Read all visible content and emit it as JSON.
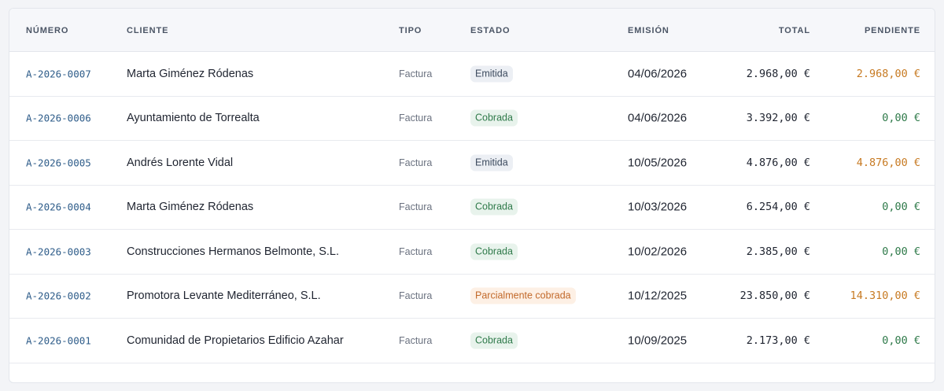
{
  "table": {
    "headers": {
      "numero": "NÚMERO",
      "cliente": "CLIENTE",
      "tipo": "TIPO",
      "estado": "ESTADO",
      "emision": "EMISIÓN",
      "total": "TOTAL",
      "pendiente": "PENDIENTE"
    },
    "rows": [
      {
        "numero": "A-2026-0007",
        "cliente": "Marta Giménez Ródenas",
        "tipo": "Factura",
        "estado": "Emitida",
        "emision": "04/06/2026",
        "total": "2.968,00 €",
        "pendiente": "2.968,00 €"
      },
      {
        "numero": "A-2026-0006",
        "cliente": "Ayuntamiento de Torrealta",
        "tipo": "Factura",
        "estado": "Cobrada",
        "emision": "04/06/2026",
        "total": "3.392,00 €",
        "pendiente": "0,00 €"
      },
      {
        "numero": "A-2026-0005",
        "cliente": "Andrés Lorente Vidal",
        "tipo": "Factura",
        "estado": "Emitida",
        "emision": "10/05/2026",
        "total": "4.876,00 €",
        "pendiente": "4.876,00 €"
      },
      {
        "numero": "A-2026-0004",
        "cliente": "Marta Giménez Ródenas",
        "tipo": "Factura",
        "estado": "Cobrada",
        "emision": "10/03/2026",
        "total": "6.254,00 €",
        "pendiente": "0,00 €"
      },
      {
        "numero": "A-2026-0003",
        "cliente": "Construcciones Hermanos Belmonte, S.L.",
        "tipo": "Factura",
        "estado": "Cobrada",
        "emision": "10/02/2026",
        "total": "2.385,00 €",
        "pendiente": "0,00 €"
      },
      {
        "numero": "A-2026-0002",
        "cliente": "Promotora Levante Mediterráneo, S.L.",
        "tipo": "Factura",
        "estado": "Parcialmente cobrada",
        "emision": "10/12/2025",
        "total": "23.850,00 €",
        "pendiente": "14.310,00 €"
      },
      {
        "numero": "A-2026-0001",
        "cliente": "Comunidad de Propietarios Edificio Azahar",
        "tipo": "Factura",
        "estado": "Cobrada",
        "emision": "10/09/2025",
        "total": "2.173,00 €",
        "pendiente": "0,00 €"
      }
    ]
  },
  "colors": {
    "link": "#2f5d8a",
    "status_emitida_bg": "#eceff4",
    "status_cobrada_bg": "#e8f3ec",
    "status_parcial_bg": "#fdf0e5",
    "pending_amount": "#c77a22",
    "zero_amount": "#2f7a4a"
  }
}
